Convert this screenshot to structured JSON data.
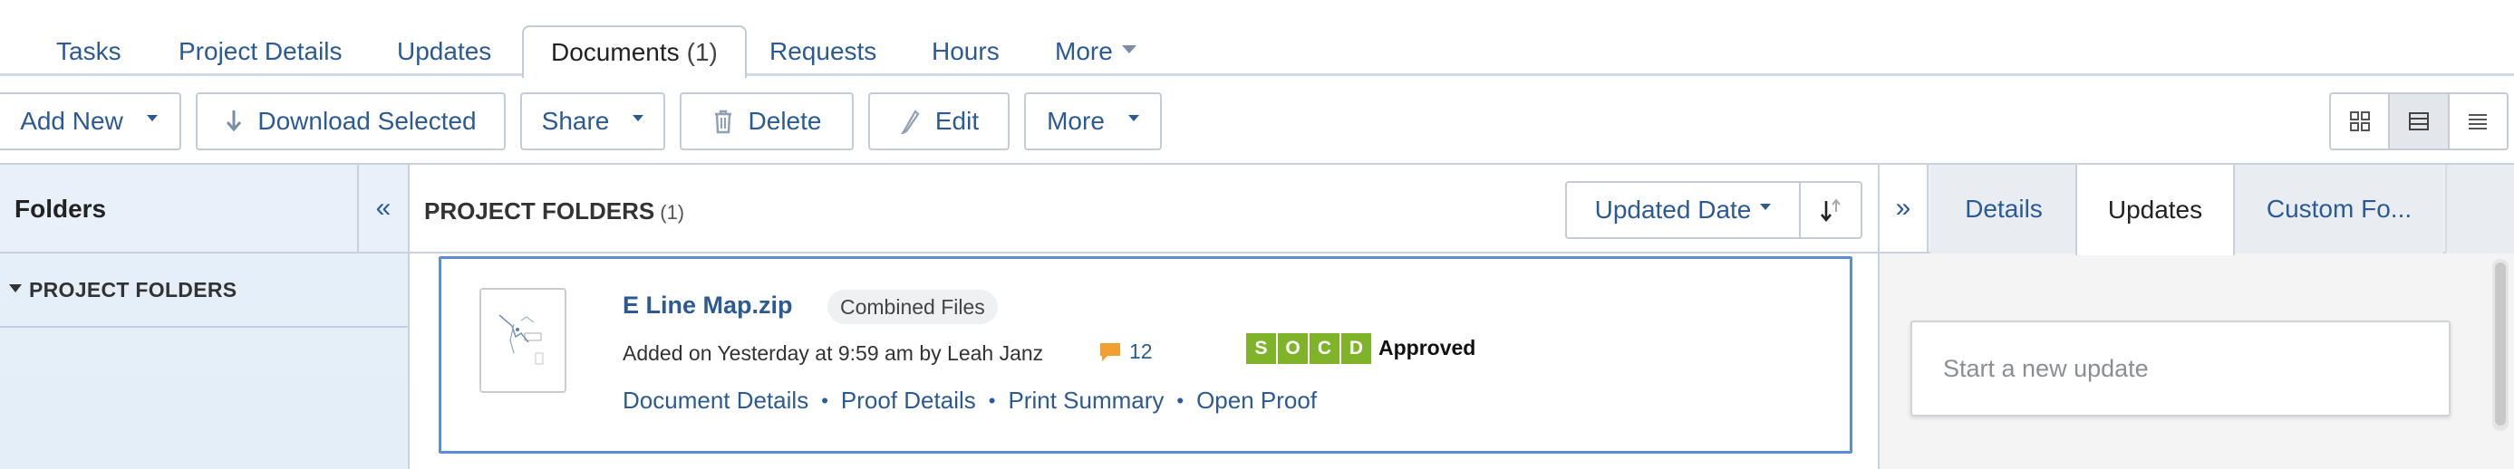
{
  "tabs": [
    {
      "label": "Tasks"
    },
    {
      "label": "Project Details"
    },
    {
      "label": "Updates"
    },
    {
      "label": "Documents",
      "count": "(1)"
    },
    {
      "label": "Requests"
    },
    {
      "label": "Hours"
    },
    {
      "label": "More"
    }
  ],
  "active_tab": "Documents",
  "toolbar": {
    "add_new": "Add New",
    "download_selected": "Download Selected",
    "share": "Share",
    "delete": "Delete",
    "edit": "Edit",
    "more": "More",
    "view_modes": [
      "grid-view-icon",
      "list-view-icon",
      "compact-list-icon"
    ],
    "active_view": "list-view-icon"
  },
  "folders_panel": {
    "title": "Folders",
    "collapse_glyph": "«",
    "tree": [
      {
        "label": "PROJECT FOLDERS"
      }
    ]
  },
  "center": {
    "title": "PROJECT FOLDERS",
    "count": "(1)",
    "sort_label": "Updated Date"
  },
  "document": {
    "name": "E Line Map.zip",
    "tag": "Combined Files",
    "meta": "Added on Yesterday at 9:59 am by Leah Janz",
    "comment_count": "12",
    "status_letters": [
      "S",
      "O",
      "C",
      "D"
    ],
    "status_text": "Approved",
    "links": [
      "Document Details",
      "Proof Details",
      "Print Summary",
      "Open Proof"
    ]
  },
  "right_panel": {
    "expand_glyph": "»",
    "tabs": [
      "Details",
      "Updates",
      "Custom Fo..."
    ],
    "active_tab": "Updates",
    "update_placeholder": "Start a new update"
  },
  "colors": {
    "link": "#2b5a94",
    "active_card_border": "#5b8fd6",
    "status_green": "#7fb42a",
    "folder_panel_bg": "#e6f0f9"
  }
}
